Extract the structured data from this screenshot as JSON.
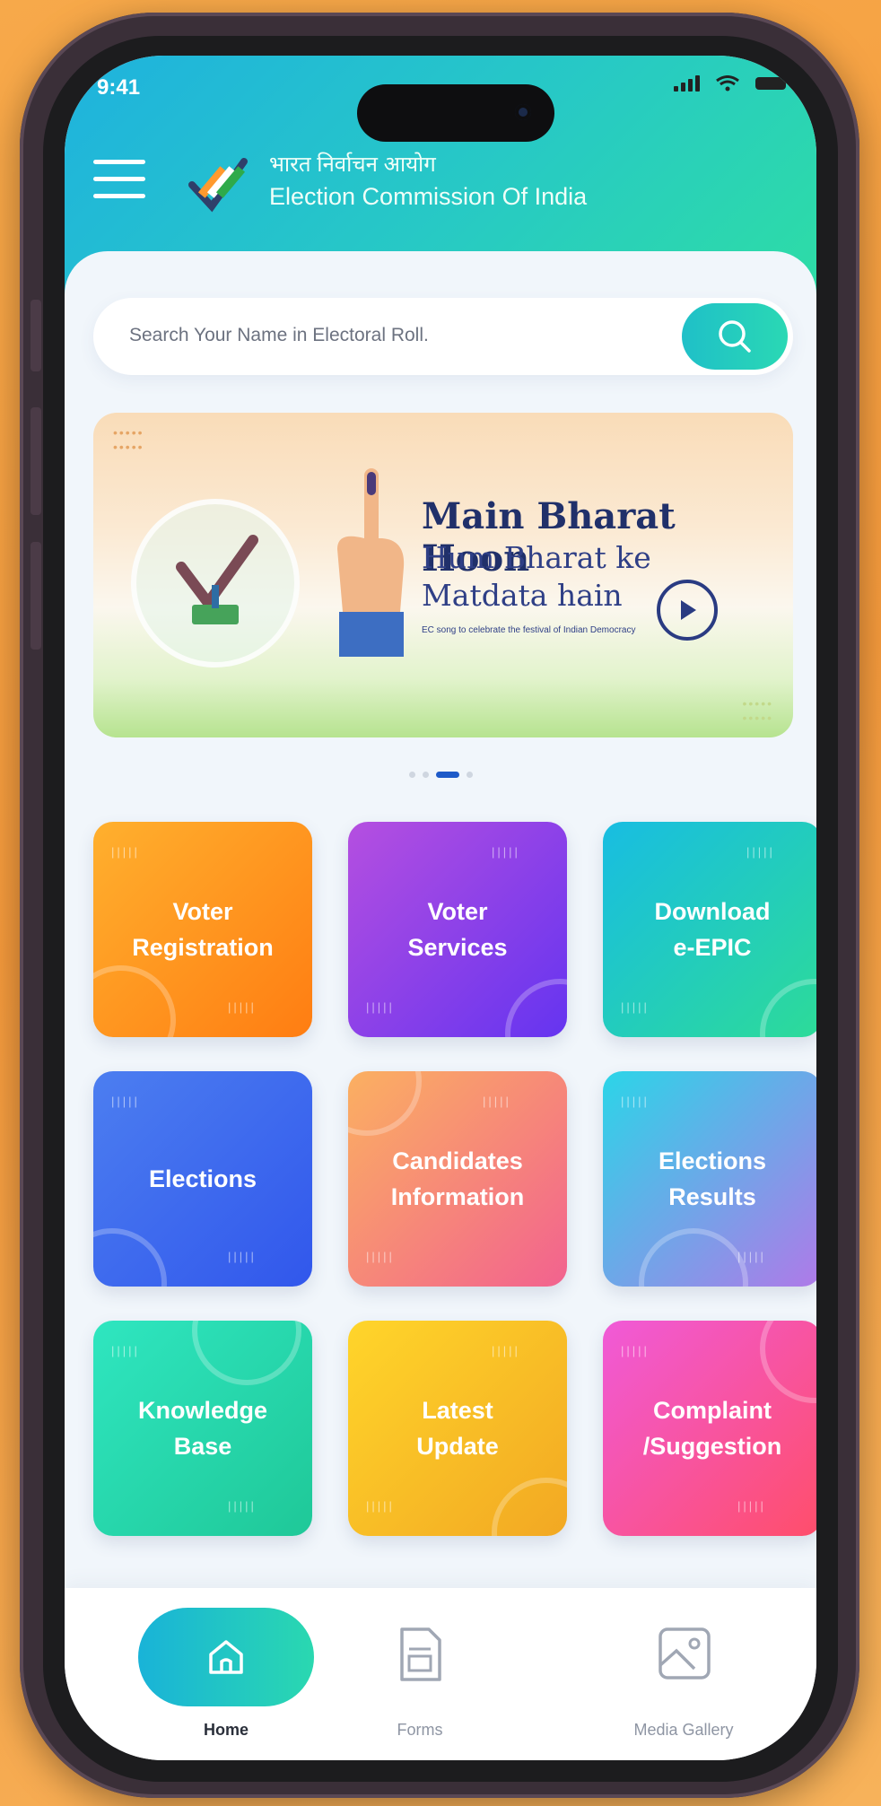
{
  "status_bar": {
    "time": "9:41"
  },
  "header": {
    "brand_hindi": "भारत निर्वाचन आयोग",
    "brand_english": "Election Commission Of India"
  },
  "search": {
    "placeholder": "Search Your Name in Electoral Roll."
  },
  "banner": {
    "title": "Main Bharat Hoon",
    "subtitle_line1": "Hum Bharat ke",
    "subtitle_line2": "Matdata hain",
    "small_text": "EC song to celebrate the festival of Indian Democracy"
  },
  "carousel": {
    "count": 4,
    "active_index": 2
  },
  "tiles": [
    {
      "label": "Voter\nRegistration",
      "colors": [
        "#ffb02e",
        "#ff7d12"
      ]
    },
    {
      "label": "Voter\nServices",
      "colors": [
        "#b54fe0",
        "#6534f0"
      ]
    },
    {
      "label": "Download\ne-EPIC",
      "colors": [
        "#18bde2",
        "#2ddb98"
      ]
    },
    {
      "label": "Elections",
      "colors": [
        "#4c7ef0",
        "#3157ec"
      ]
    },
    {
      "label": "Candidates\nInformation",
      "colors": [
        "#fbb061",
        "#f2628f"
      ]
    },
    {
      "label": "Elections\nResults",
      "colors": [
        "#2bd5e8",
        "#b079e8"
      ]
    },
    {
      "label": "Knowledge\nBase",
      "colors": [
        "#2fe6c0",
        "#1fc898"
      ]
    },
    {
      "label": "Latest\nUpdate",
      "colors": [
        "#ffd52a",
        "#f2a823"
      ]
    },
    {
      "label": "Complaint\n/Suggestion",
      "colors": [
        "#f05ad8",
        "#ff4e6a"
      ]
    }
  ],
  "bottom_nav": [
    {
      "label": "Home",
      "icon": "home-icon",
      "active": true
    },
    {
      "label": "Forms",
      "icon": "document-icon",
      "active": false
    },
    {
      "label": "Media Gallery",
      "icon": "image-icon",
      "active": false
    }
  ]
}
